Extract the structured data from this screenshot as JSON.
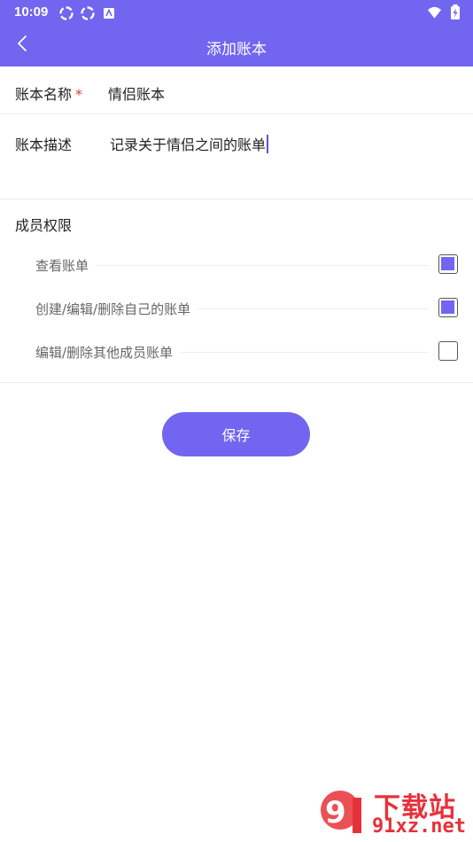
{
  "status_bar": {
    "time": "10:09",
    "left_icons": [
      "sync-icon",
      "sync-icon",
      "app-notification-icon"
    ],
    "right_icons": [
      "wifi-icon",
      "battery-charging-icon"
    ]
  },
  "app_bar": {
    "title": "添加账本",
    "back_icon": "chevron-left-icon"
  },
  "form": {
    "name": {
      "label": "账本名称",
      "required_mark": "*",
      "value": "情侣账本"
    },
    "description": {
      "label": "账本描述",
      "value": "记录关于情侣之间的账单"
    }
  },
  "permissions": {
    "title": "成员权限",
    "items": [
      {
        "label": "查看账单",
        "checked": true
      },
      {
        "label": "创建/编辑/删除自己的账单",
        "checked": true
      },
      {
        "label": "编辑/删除其他成员账单",
        "checked": false
      }
    ]
  },
  "save_button": {
    "label": "保存"
  },
  "watermark": {
    "brand": "下载站",
    "site": "91xz.net",
    "logo_text": "91"
  },
  "colors": {
    "primary": "#7265f0",
    "required": "#e53935",
    "watermark": "#e7313a"
  }
}
